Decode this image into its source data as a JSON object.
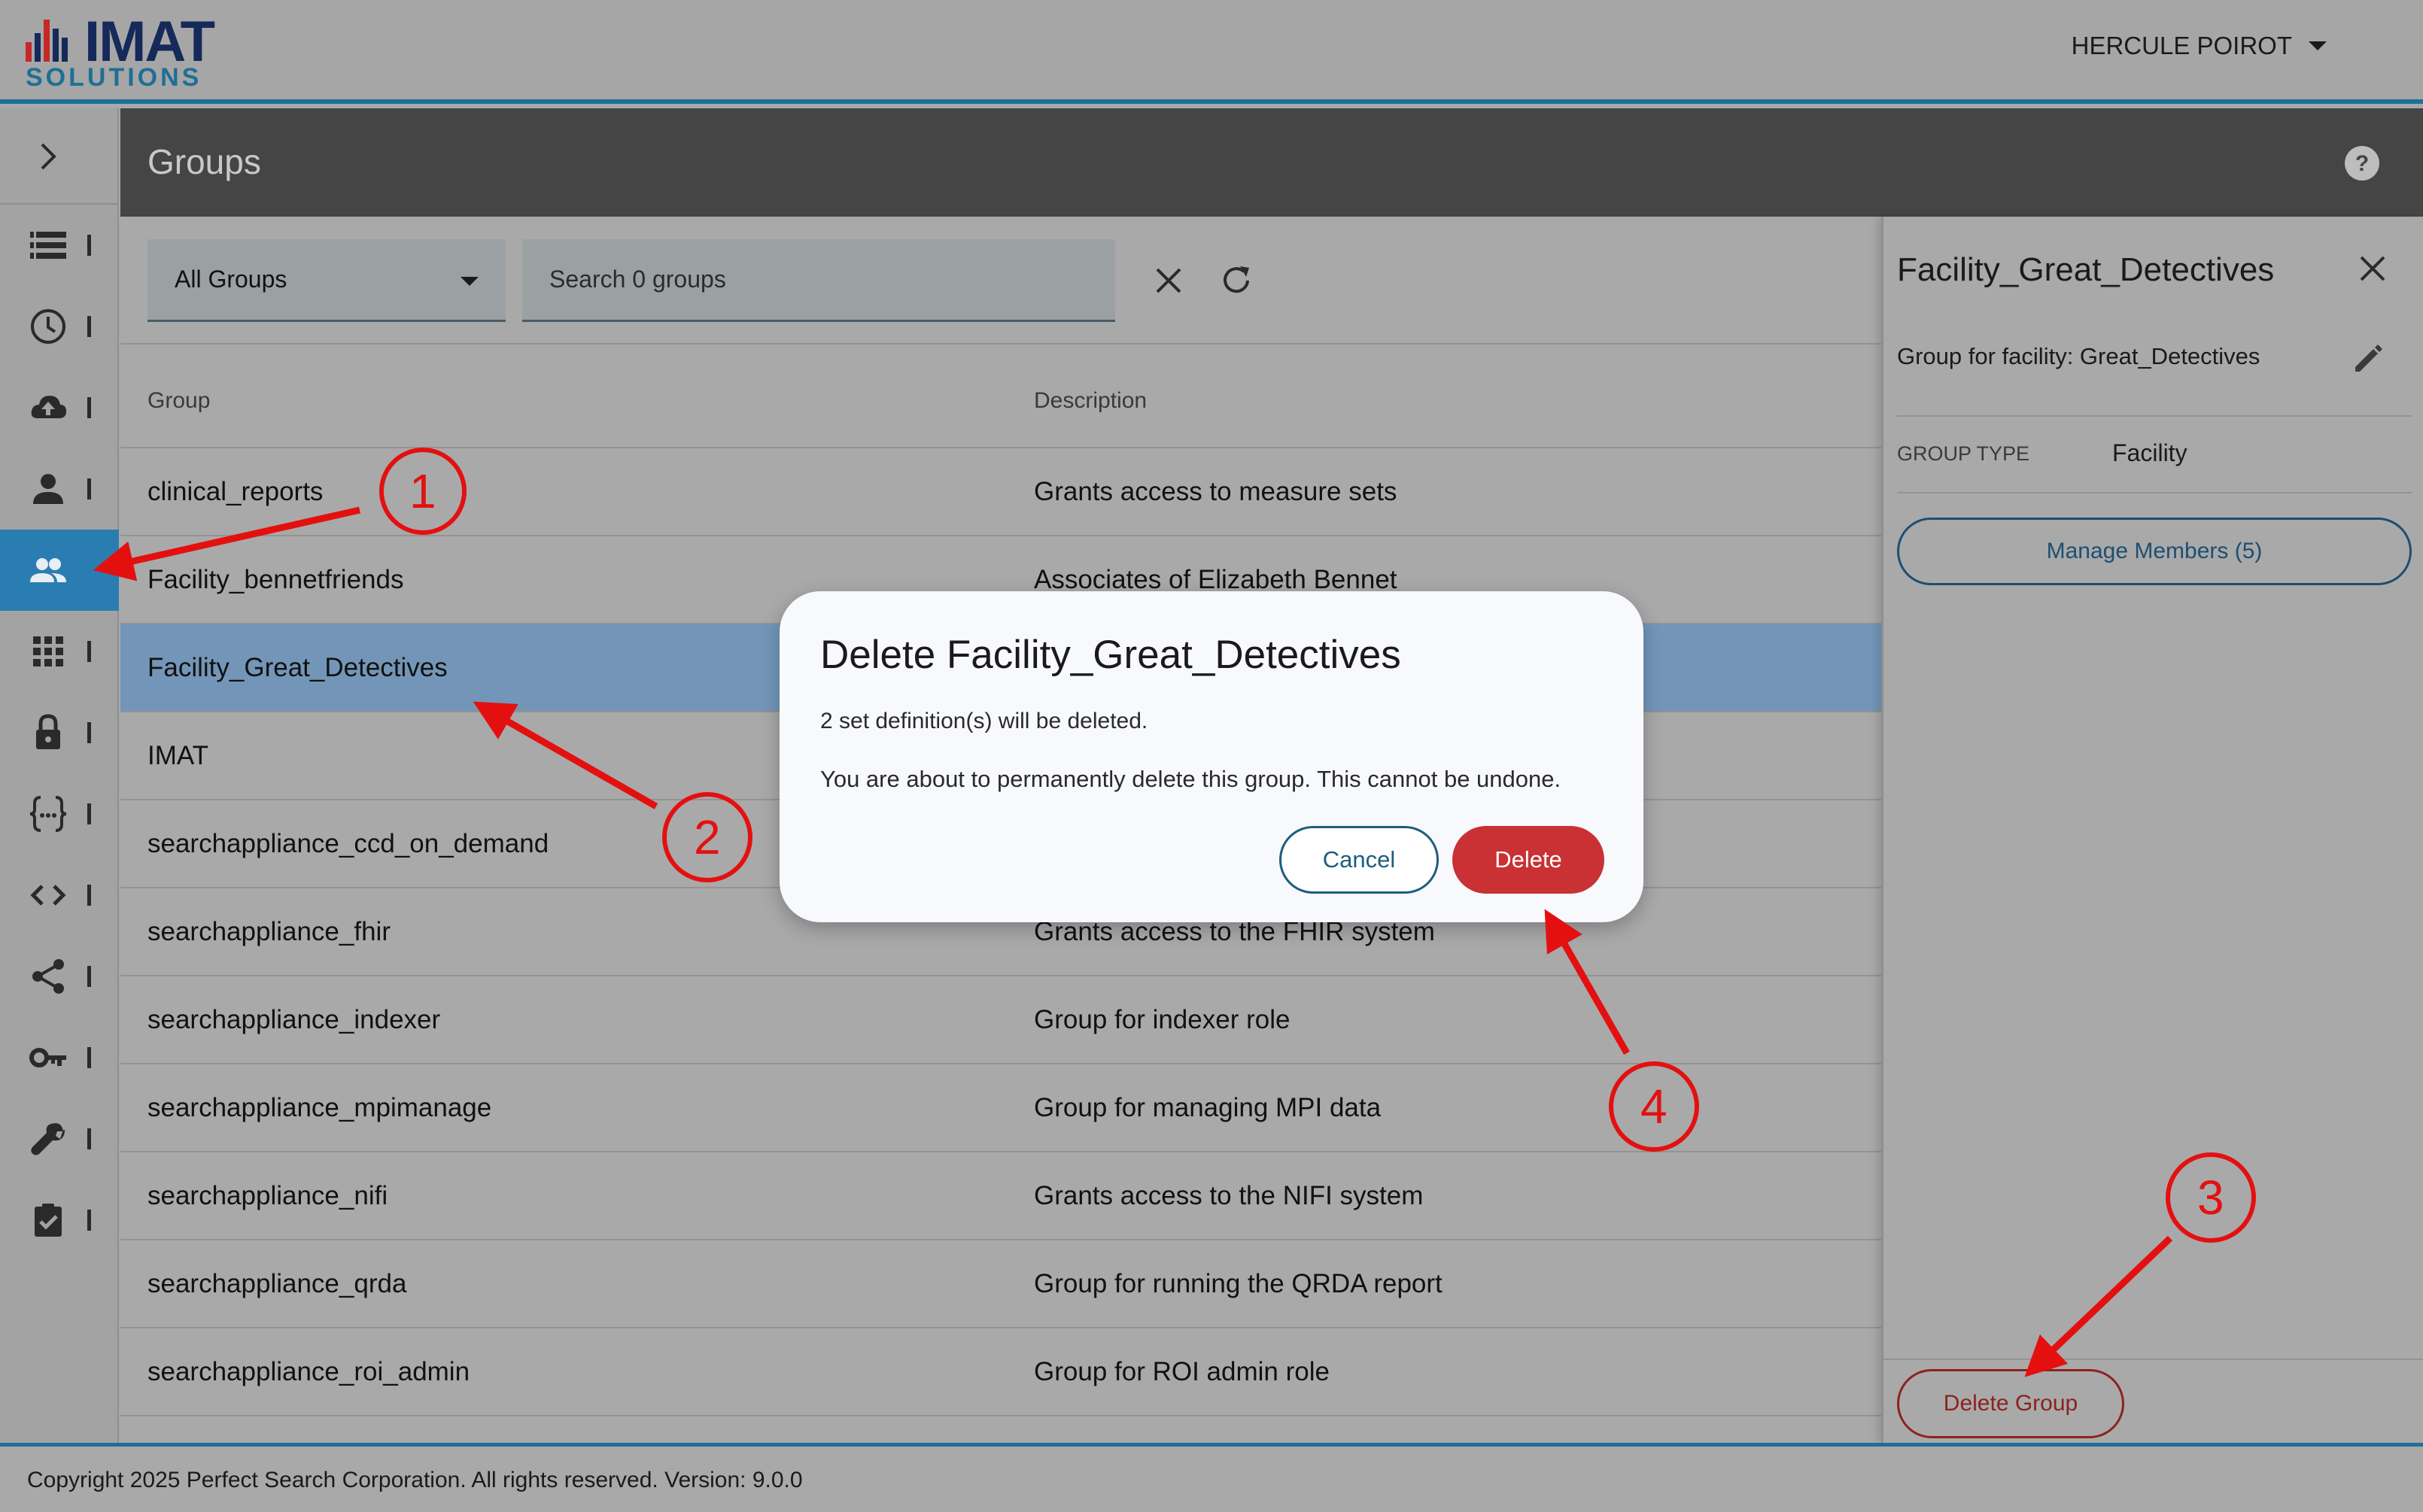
{
  "app": {
    "logo_main": "IMAT",
    "logo_sub": "SOLUTIONS",
    "user_name": "HERCULE POIROT"
  },
  "page": {
    "title": "Groups"
  },
  "sidebar": {
    "items": [
      {
        "icon": "list-icon"
      },
      {
        "icon": "clock-icon"
      },
      {
        "icon": "cloud-upload-icon"
      },
      {
        "icon": "person-icon"
      },
      {
        "icon": "group-icon",
        "active": true
      },
      {
        "icon": "apps-grid-icon"
      },
      {
        "icon": "lock-icon"
      },
      {
        "icon": "braces-icon"
      },
      {
        "icon": "code-icon"
      },
      {
        "icon": "share-icon"
      },
      {
        "icon": "key-icon"
      },
      {
        "icon": "wrench-icon"
      },
      {
        "icon": "clipboard-check-icon"
      }
    ]
  },
  "filters": {
    "group_filter": "All Groups",
    "search_placeholder": "Search 0 groups"
  },
  "table": {
    "headers": [
      "Group",
      "Description"
    ],
    "rows": [
      {
        "group": "clinical_reports",
        "description": "Grants access to measure sets"
      },
      {
        "group": "Facility_bennetfriends",
        "description": "Associates of Elizabeth Bennet"
      },
      {
        "group": "Facility_Great_Detectives",
        "description": "",
        "selected": true
      },
      {
        "group": "IMAT",
        "description": ""
      },
      {
        "group": "searchappliance_ccd_on_demand",
        "description": ""
      },
      {
        "group": "searchappliance_fhir",
        "description": "Grants access to the FHIR system"
      },
      {
        "group": "searchappliance_indexer",
        "description": "Group for indexer role"
      },
      {
        "group": "searchappliance_mpimanage",
        "description": "Group for managing MPI data"
      },
      {
        "group": "searchappliance_nifi",
        "description": "Grants access to the NIFI system"
      },
      {
        "group": "searchappliance_qrda",
        "description": "Group for running the QRDA report"
      },
      {
        "group": "searchappliance_roi_admin",
        "description": "Group for ROI admin role"
      }
    ]
  },
  "panel": {
    "title": "Facility_Great_Detectives",
    "description": "Group for facility: Great_Detectives",
    "group_type_label": "GROUP TYPE",
    "group_type_value": "Facility",
    "manage_members_label": "Manage Members (5)",
    "delete_group_label": "Delete Group"
  },
  "dialog": {
    "title": "Delete Facility_Great_Detectives",
    "line1": "2 set definition(s) will be deleted.",
    "line2": "You are about to permanently delete this group. This cannot be undone.",
    "cancel_label": "Cancel",
    "delete_label": "Delete"
  },
  "footer": {
    "text": "Copyright 2025 Perfect Search Corporation. All rights reserved. Version: 9.0.0"
  },
  "annotations": {
    "step1": "1",
    "step2": "2",
    "step3": "3",
    "step4": "4"
  },
  "colors": {
    "accent": "#1f6f96",
    "selected_row": "#7396b8",
    "danger": "#c93134",
    "annotation": "#e41010"
  }
}
